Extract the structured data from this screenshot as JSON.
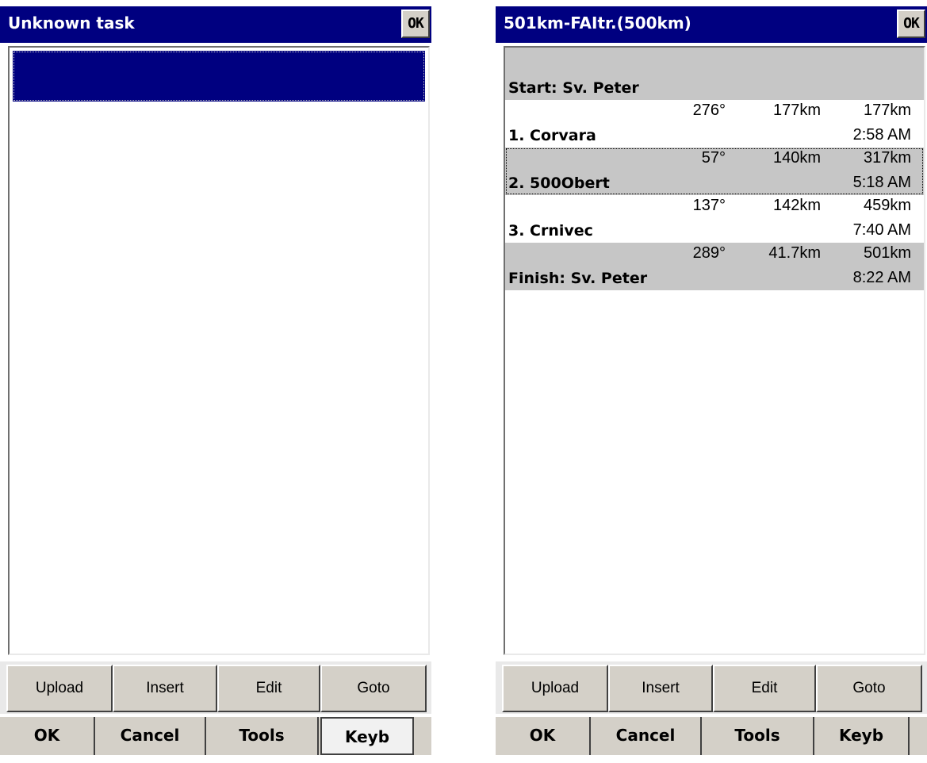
{
  "left": {
    "title": "Unknown task",
    "ok_label": "OK",
    "buttons": [
      "Upload",
      "Insert",
      "Edit",
      "Goto"
    ],
    "menu": [
      "OK",
      "Cancel",
      "Tools",
      "Keyb"
    ],
    "active_menu": "Keyb"
  },
  "right": {
    "title": "501km-FAItr.(500km)",
    "ok_label": "OK",
    "start": "Start: Sv. Peter",
    "legs": [
      {
        "bearing": "276°",
        "leg": "177km",
        "total": "177km",
        "name": "1. Corvara",
        "time": "2:58 AM"
      },
      {
        "bearing": "57°",
        "leg": "140km",
        "total": "317km",
        "name": "2. 500Obert",
        "time": "5:18 AM"
      },
      {
        "bearing": "137°",
        "leg": "142km",
        "total": "459km",
        "name": "3. Crnivec",
        "time": "7:40 AM"
      },
      {
        "bearing": "289°",
        "leg": "41.7km",
        "total": "501km",
        "name": "Finish: Sv. Peter",
        "time": "8:22 AM"
      }
    ],
    "buttons": [
      "Upload",
      "Insert",
      "Edit",
      "Goto"
    ],
    "menu": [
      "OK",
      "Cancel",
      "Tools",
      "Keyb"
    ]
  },
  "colors": {
    "titlebar": "#000080",
    "button_face": "#d4d0c8",
    "row_gray": "#c6c6c6",
    "selection": "#000080"
  }
}
